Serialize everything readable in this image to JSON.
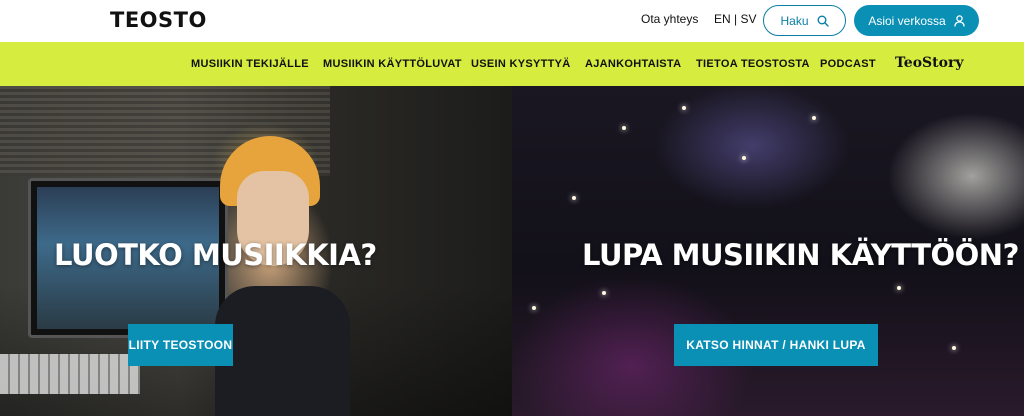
{
  "header": {
    "logo": "TEOSTO",
    "contact_label": "Ota yhteys",
    "lang_en": "EN",
    "lang_sep": "|",
    "lang_sv": "SV",
    "search_label": "Haku",
    "login_label": "Asioi verkossa"
  },
  "nav": {
    "items": [
      "MUSIIKIN TEKIJÄLLE",
      "MUSIIKIN KÄYTTÖLUVAT",
      "USEIN KYSYTTYÄ",
      "AJANKOHTAISTA",
      "TIETOA TEOSTOSTA",
      "PODCAST",
      "TeoStory"
    ]
  },
  "hero": {
    "left": {
      "title": "LUOTKO MUSIIKKIA?",
      "button": "LIITY TEOSTOON"
    },
    "right": {
      "title": "LUPA MUSIIKIN KÄYTTÖÖN?",
      "button": "KATSO HINNAT / HANKI LUPA"
    }
  },
  "colors": {
    "accent_nav": "#d6ec3e",
    "primary_button": "#0a8fb5",
    "search_border": "#0a7ea4"
  },
  "icons": {
    "search": "search-icon",
    "user": "user-icon"
  }
}
